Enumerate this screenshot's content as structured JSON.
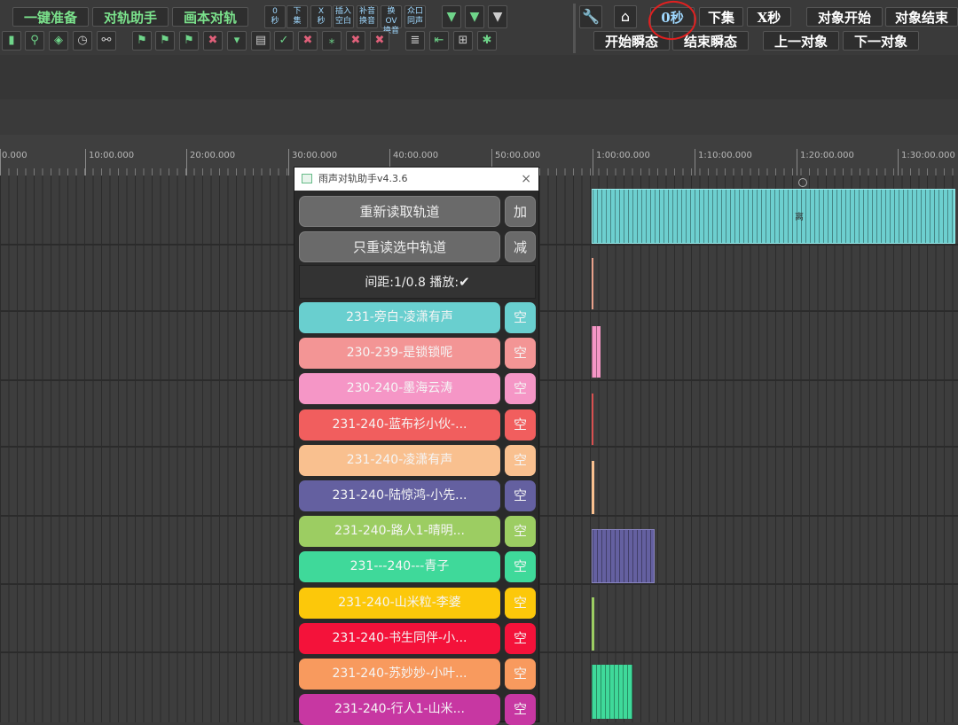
{
  "toolbar": {
    "row1_left": [
      "一键准备",
      "对轨助手",
      "画本对轨"
    ],
    "small_buttons": [
      {
        "line1": "0",
        "line2": "秒"
      },
      {
        "line1": "下",
        "line2": "集"
      },
      {
        "line1": "X",
        "line2": "秒"
      },
      {
        "line1": "插入",
        "line2": "空白"
      },
      {
        "line1": "补音",
        "line2": "换音"
      },
      {
        "line1": "换OV",
        "line2": "换音"
      },
      {
        "line1": "众口",
        "line2": "同声"
      }
    ],
    "row1_right": [
      "0秒",
      "下集",
      "X秒",
      "对象开始",
      "对象结束"
    ],
    "row2_right": [
      "开始瞬态",
      "结束瞬态",
      "上一对象",
      "下一对象"
    ]
  },
  "ruler": {
    "labels": [
      "0.000",
      "10:00.000",
      "20:00.000",
      "30:00.000",
      "40:00.000",
      "50:00.000",
      "1:00:00.000",
      "1:10:00.000",
      "1:20:00.000",
      "1:30:00.000"
    ]
  },
  "timeline": {
    "main_clip_label": "离"
  },
  "dialog": {
    "title": "雨声对轨助手v4.3.6",
    "close": "×",
    "reload_all": "重新读取轨道",
    "add": "加",
    "reload_selected": "只重读选中轨道",
    "subtract": "减",
    "spacing_label": "间距:1/0.8",
    "play_label": "播放:",
    "play_check": "✔",
    "tracks": [
      {
        "label": "231-旁白-凌潇有声",
        "side": "空",
        "color": "#69cfcf"
      },
      {
        "label": "230-239-是锁锁呢",
        "side": "空",
        "color": "#f39595"
      },
      {
        "label": "230-240-墨海云涛",
        "side": "空",
        "color": "#f596c6"
      },
      {
        "label": "231-240-蓝布衫小伙-...",
        "side": "空",
        "color": "#f15e5e"
      },
      {
        "label": "231-240-凌潇有声",
        "side": "空",
        "color": "#f9c08f"
      },
      {
        "label": "231-240-陆惊鸿-小先...",
        "side": "空",
        "color": "#6460a0"
      },
      {
        "label": "231-240-路人1-晴明...",
        "side": "空",
        "color": "#9ccd62"
      },
      {
        "label": "231---240---青子",
        "side": "空",
        "color": "#3fd99a"
      },
      {
        "label": "231-240-山米粒-李婆",
        "side": "空",
        "color": "#fcc80a"
      },
      {
        "label": "231-240-书生同伴-小...",
        "side": "空",
        "color": "#f4123a"
      },
      {
        "label": "231-240-苏妙妙-小叶...",
        "side": "空",
        "color": "#f89a5e"
      },
      {
        "label": "231-240-行人1-山米...",
        "side": "空",
        "color": "#c737a2"
      }
    ]
  }
}
